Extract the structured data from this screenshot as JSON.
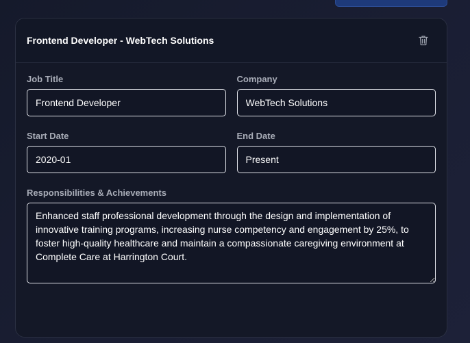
{
  "entry": {
    "title": "Frontend Developer - WebTech Solutions",
    "delete_icon": "trash-icon"
  },
  "fields": {
    "job_title": {
      "label": "Job Title",
      "value": "Frontend Developer"
    },
    "company": {
      "label": "Company",
      "value": "WebTech Solutions"
    },
    "start_date": {
      "label": "Start Date",
      "value": "2020-01"
    },
    "end_date": {
      "label": "End Date",
      "value": "Present"
    },
    "responsibilities": {
      "label": "Responsibilities & Achievements",
      "value": "Enhanced staff professional development through the design and implementation of innovative training programs, increasing nurse competency and engagement by 25%, to foster high-quality healthcare and maintain a compassionate caregiving environment at Complete Care at Harrington Court."
    }
  },
  "colors": {
    "background": "#161a2c",
    "card": "#141827",
    "input_border": "#e2e4ea",
    "label": "#a9adb8",
    "top_button": "#1e3a7a"
  }
}
